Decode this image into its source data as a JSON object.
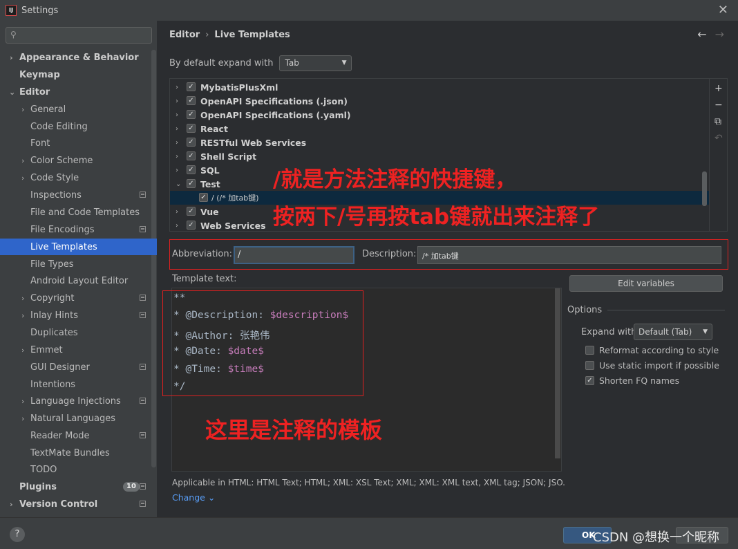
{
  "window": {
    "title": "Settings",
    "app_icon_text": "IJ"
  },
  "search": {
    "value": "",
    "placeholder": ""
  },
  "sidebar": {
    "items": [
      {
        "label": "Appearance & Behavior",
        "chevron": "›"
      },
      {
        "label": "Keymap"
      },
      {
        "label": "Editor",
        "chevron": "⌄"
      },
      {
        "label": "General",
        "chevron": "›"
      },
      {
        "label": "Code Editing"
      },
      {
        "label": "Font"
      },
      {
        "label": "Color Scheme",
        "chevron": "›"
      },
      {
        "label": "Code Style",
        "chevron": "›"
      },
      {
        "label": "Inspections"
      },
      {
        "label": "File and Code Templates"
      },
      {
        "label": "File Encodings"
      },
      {
        "label": "Live Templates"
      },
      {
        "label": "File Types"
      },
      {
        "label": "Android Layout Editor"
      },
      {
        "label": "Copyright",
        "chevron": "›"
      },
      {
        "label": "Inlay Hints",
        "chevron": "›"
      },
      {
        "label": "Duplicates"
      },
      {
        "label": "Emmet",
        "chevron": "›"
      },
      {
        "label": "GUI Designer"
      },
      {
        "label": "Intentions"
      },
      {
        "label": "Language Injections",
        "chevron": "›"
      },
      {
        "label": "Natural Languages",
        "chevron": "›"
      },
      {
        "label": "Reader Mode"
      },
      {
        "label": "TextMate Bundles"
      },
      {
        "label": "TODO"
      },
      {
        "label": "Plugins",
        "badge": "10"
      },
      {
        "label": "Version Control",
        "chevron": "›"
      }
    ]
  },
  "header": {
    "breadcrumb": [
      "Editor",
      "Live Templates"
    ],
    "separator": "›",
    "back_arrow": "←",
    "forward_arrow": "→"
  },
  "expand_default": {
    "label": "By default expand with",
    "value": "Tab"
  },
  "template_groups": [
    {
      "name": "MybatisPlusXml",
      "checked": true
    },
    {
      "name": "OpenAPI Specifications (.json)",
      "checked": true
    },
    {
      "name": "OpenAPI Specifications (.yaml)",
      "checked": true
    },
    {
      "name": "React",
      "checked": true
    },
    {
      "name": "RESTful Web Services",
      "checked": true
    },
    {
      "name": "Shell Script",
      "checked": true
    },
    {
      "name": "SQL",
      "checked": true
    },
    {
      "name": "Test",
      "checked": true,
      "expanded": true
    },
    {
      "name": "/ (/*  加tab键)",
      "checked": true,
      "child": true
    },
    {
      "name": "Vue",
      "checked": true
    },
    {
      "name": "Web Services",
      "checked": true
    }
  ],
  "list_toolbar": {
    "add": "+",
    "remove": "−",
    "copy": "⧉",
    "undo": "↶"
  },
  "abbreviation": {
    "label": "Abbreviation:",
    "value": "/"
  },
  "description": {
    "label": "Description:",
    "value": "/*  加tab键"
  },
  "template_text": {
    "label": "Template text:",
    "lines": [
      {
        "plain": "**",
        "var": ""
      },
      {
        "plain": "* @Description: ",
        "var": "$description$"
      },
      {
        "plain": "* @Author: 张艳伟",
        "var": ""
      },
      {
        "plain": "* @Date: ",
        "var": "$date$"
      },
      {
        "plain": "* @Time: ",
        "var": "$time$"
      },
      {
        "plain": "*/",
        "var": ""
      }
    ]
  },
  "edit_variables": "Edit variables",
  "options": {
    "title": "Options",
    "expand_with_label": "Expand with",
    "expand_with_value": "Default (Tab)",
    "checkboxes": [
      {
        "label": "Reformat according to style",
        "checked": false
      },
      {
        "label": "Use static import if possible",
        "checked": false
      },
      {
        "label": "Shorten FQ names",
        "checked": true
      }
    ]
  },
  "applicable": "Applicable in HTML: HTML Text; HTML; XML: XSL Text; XML; XML: XML text, XML tag; JSON; JSO...",
  "change_link": "Change ⌄",
  "annotations": {
    "note1_line1": "/就是方法注释的快捷键，",
    "note1_line2": "按两下/号再按tab键就出来注释了",
    "note2": "这里是注释的模板"
  },
  "footer": {
    "help": "?",
    "ok": "OK",
    "watermark": "CSDN @想换一个昵称"
  },
  "colors": {
    "accent": "#2f65ca",
    "annotation_red": "#ee2222",
    "template_var": "#c77dbb"
  }
}
